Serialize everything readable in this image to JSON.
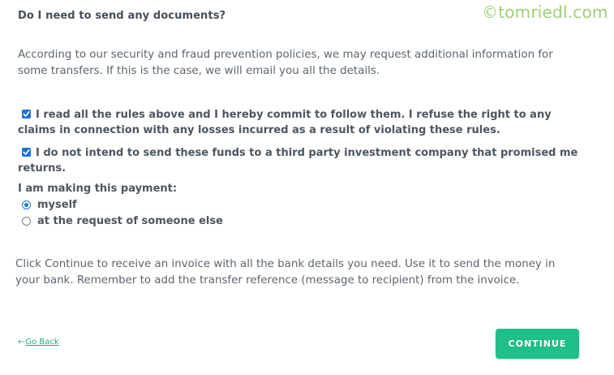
{
  "heading": "Do I need to send any documents?",
  "watermark": "©tomriedl.com",
  "intro_paragraph": "According to our security and fraud prevention policies, we may request additional information for some transfers. If this is the case, we will email you all the details.",
  "checkboxes": [
    {
      "label": "I read all the rules above and I hereby commit to follow them. I refuse the right to any claims in connection with any losses incurred as a result of violating these rules.",
      "checked": true
    },
    {
      "label": "I do not intend to send these funds to a third party investment company that promised me returns.",
      "checked": true
    }
  ],
  "payment": {
    "title": "I am making this payment:",
    "options": [
      {
        "label": "myself",
        "selected": true
      },
      {
        "label": "at the request of someone else",
        "selected": false
      }
    ]
  },
  "outro_paragraph": "Click Continue to receive an invoice with all the bank details you need. Use it to send the money in your bank. Remember to add the transfer reference (message to recipient) from the invoice.",
  "footer": {
    "back_arrow": "←",
    "back_label": "Go Back",
    "continue_label": "CONTINUE"
  },
  "colors": {
    "accent_green": "#1ebf88",
    "checkbox_blue": "#1a73d9",
    "watermark_green": "#9ecf74"
  }
}
